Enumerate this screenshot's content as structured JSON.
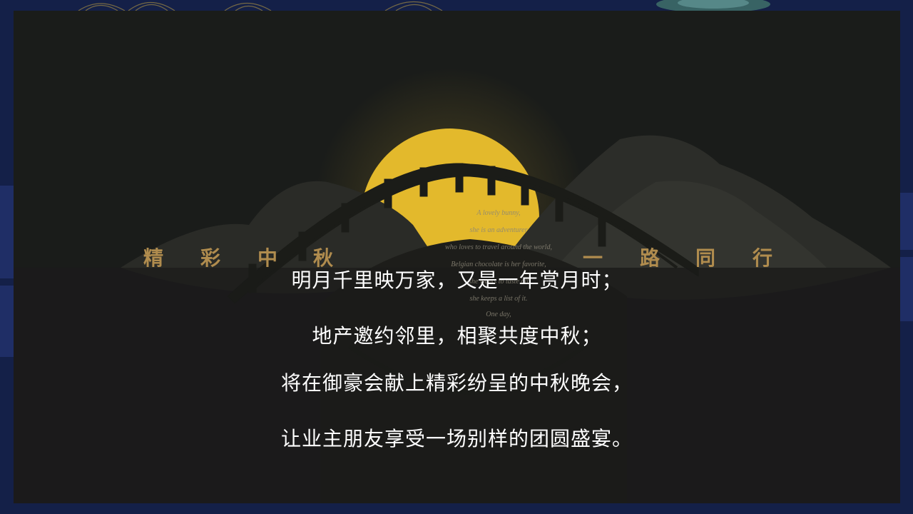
{
  "banner": {
    "chars": [
      "精",
      "彩",
      "中",
      "秋",
      "一",
      "路",
      "同",
      "行"
    ]
  },
  "poem": {
    "lines": [
      "A lovely bunny,",
      "she is an adventurer",
      "who loves to travel around the world,",
      "Belgian chocolate is her favorite,",
      "she wants to taste all",
      "she keeps a list of it.",
      "One day,"
    ]
  },
  "verses": [
    "明月千里映万家，又是一年赏月时；",
    "地产邀约邻里，相聚共度中秋；",
    "将在御豪会献上精彩纷呈的中秋晚会，",
    "让业主朋友享受一场别样的团圆盛宴。"
  ],
  "colors": {
    "frame": "#142048",
    "panel": "#1a1c1a",
    "moon": "#e3b92c",
    "banner": "#b08c4e",
    "verse_text": "#ffffff"
  }
}
